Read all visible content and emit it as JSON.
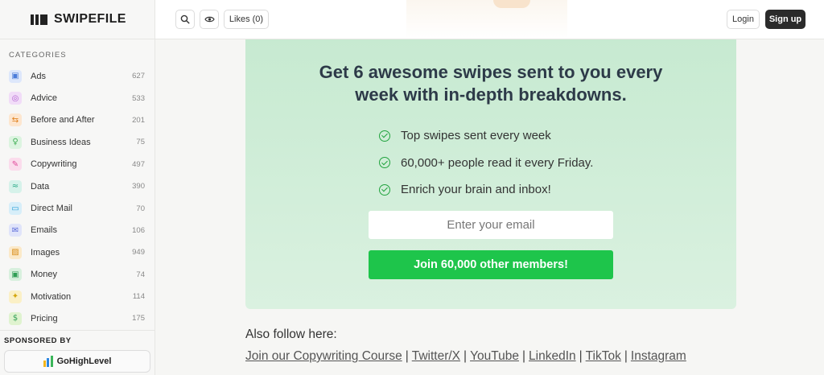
{
  "app": {
    "name": "SWIPEFILE"
  },
  "sidebar": {
    "categories_title": "CATEGORIES",
    "items": [
      {
        "label": "Ads",
        "count": "627",
        "icon": "ad-icon",
        "color": "#4a7bd9",
        "bg": "#dde7fb"
      },
      {
        "label": "Advice",
        "count": "533",
        "icon": "life-ring-icon",
        "color": "#b25fd0",
        "bg": "#f1dcf8"
      },
      {
        "label": "Before and After",
        "count": "201",
        "icon": "arrows-swap-icon",
        "color": "#e0811f",
        "bg": "#fde6cf"
      },
      {
        "label": "Business Ideas",
        "count": "75",
        "icon": "lightbulb-icon",
        "color": "#3fae54",
        "bg": "#dcf4e0"
      },
      {
        "label": "Copywriting",
        "count": "497",
        "icon": "pen-tool-icon",
        "color": "#e04a9b",
        "bg": "#fbdcec"
      },
      {
        "label": "Data",
        "count": "390",
        "icon": "dna-icon",
        "color": "#2eab8a",
        "bg": "#d6f2ea"
      },
      {
        "label": "Direct Mail",
        "count": "70",
        "icon": "mail-card-icon",
        "color": "#2a9fd6",
        "bg": "#d7eef9"
      },
      {
        "label": "Emails",
        "count": "106",
        "icon": "envelope-icon",
        "color": "#5a6ad9",
        "bg": "#e0e4fa"
      },
      {
        "label": "Images",
        "count": "949",
        "icon": "image-icon",
        "color": "#d98e1a",
        "bg": "#fbe9c9"
      },
      {
        "label": "Money",
        "count": "74",
        "icon": "banknote-icon",
        "color": "#2f9e55",
        "bg": "#d8f0de"
      },
      {
        "label": "Motivation",
        "count": "114",
        "icon": "sparkles-icon",
        "color": "#d4a60e",
        "bg": "#fbf0c6"
      },
      {
        "label": "Pricing",
        "count": "175",
        "icon": "dollar-icon",
        "color": "#2f9e55",
        "bg": "#dff3cf"
      }
    ],
    "sponsor_title": "SPONSORED BY",
    "sponsor_name": "GoHighLevel"
  },
  "topbar": {
    "likes_label": "Likes (0)",
    "login_label": "Login",
    "signup_label": "Sign up"
  },
  "newsletter": {
    "headline_line1": "Get 6 awesome swipes sent to you every",
    "headline_line2": "week with in-depth breakdowns.",
    "benefits": [
      "Top swipes sent every week",
      "60,000+ people read it every Friday.",
      "Enrich your brain and inbox!"
    ],
    "email_placeholder": "Enter your email",
    "email_value": "",
    "cta_label": "Join 60,000 other members!",
    "accent_color": "#1ec54b"
  },
  "follow": {
    "title": "Also follow here:",
    "links": [
      "Join our Copywriting Course",
      "Twitter/X",
      "YouTube",
      "LinkedIn",
      "TikTok",
      "Instagram"
    ],
    "separator": "|"
  }
}
